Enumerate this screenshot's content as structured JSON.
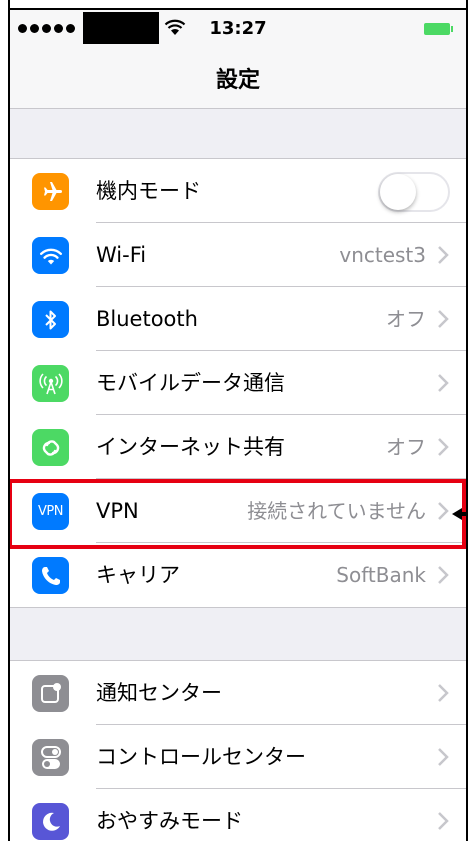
{
  "status_bar": {
    "time": "13:27"
  },
  "nav": {
    "title": "設定"
  },
  "colors": {
    "airplane": "#ff9500",
    "wifi": "#007aff",
    "bluetooth": "#007aff",
    "cellular": "#4cd964",
    "hotspot": "#4cd964",
    "vpn": "#007aff",
    "carrier": "#007aff",
    "notifications": "#8e8e93",
    "control_center": "#8e8e93",
    "do_not_disturb": "#5856d6",
    "highlight": "#e60012"
  },
  "settings_group1": [
    {
      "icon": "airplane-icon",
      "label": "機内モード",
      "value": "",
      "toggle": false
    },
    {
      "icon": "wifi-icon",
      "label": "Wi-Fi",
      "value": "vnctest3"
    },
    {
      "icon": "bluetooth-icon",
      "label": "Bluetooth",
      "value": "オフ"
    },
    {
      "icon": "cellular-icon",
      "label": "モバイルデータ通信",
      "value": ""
    },
    {
      "icon": "hotspot-icon",
      "label": "インターネット共有",
      "value": "オフ"
    },
    {
      "icon": "vpn-icon",
      "icon_text": "VPN",
      "label": "VPN",
      "value": "接続されていません"
    },
    {
      "icon": "phone-icon",
      "label": "キャリア",
      "value": "SoftBank"
    }
  ],
  "settings_group2": [
    {
      "icon": "notification-center-icon",
      "label": "通知センター",
      "value": ""
    },
    {
      "icon": "control-center-icon",
      "label": "コントロールセンター",
      "value": ""
    },
    {
      "icon": "moon-icon",
      "label": "おやすみモード",
      "value": ""
    }
  ]
}
